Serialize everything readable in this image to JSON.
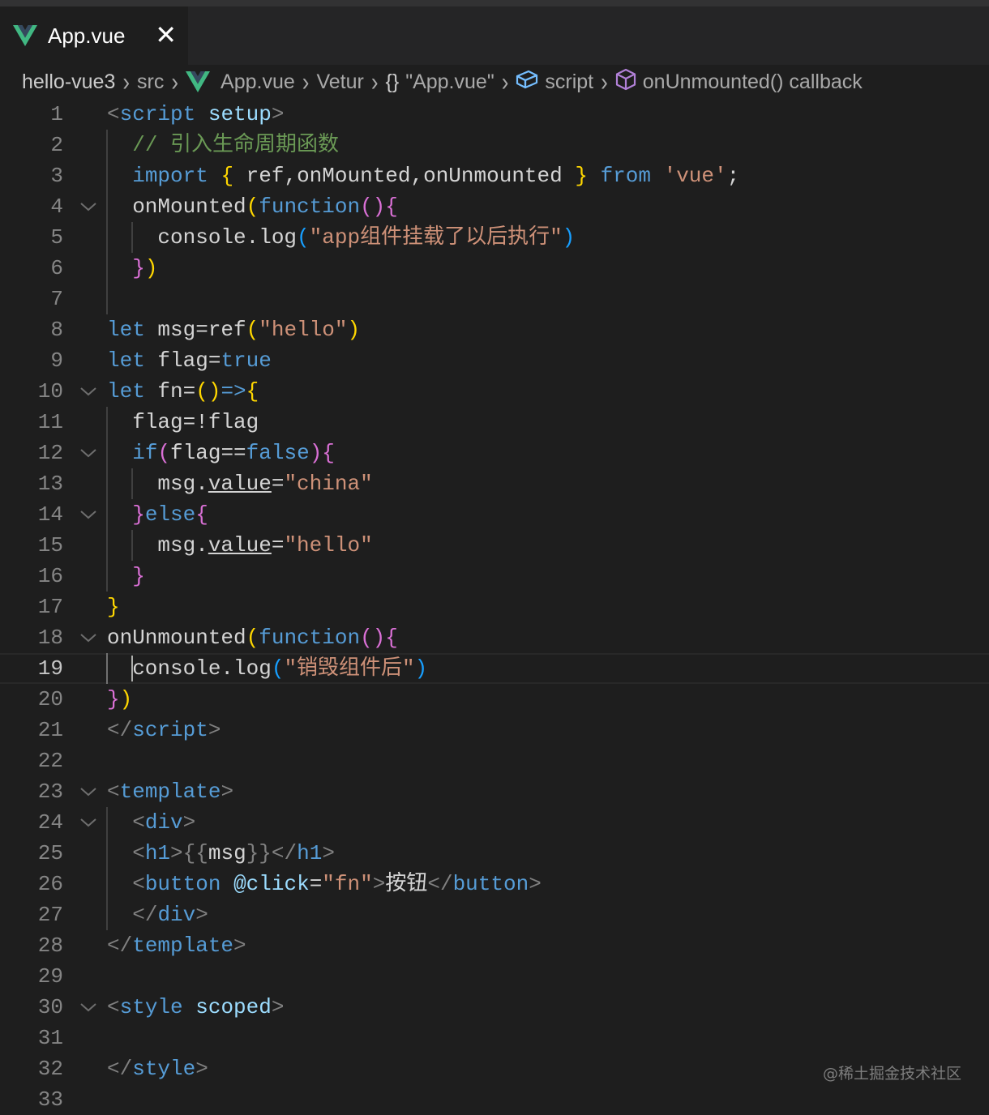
{
  "tab": {
    "title": "App.vue",
    "close": "✕"
  },
  "breadcrumb": [
    {
      "label": "hello-vue3",
      "icon": ""
    },
    {
      "label": "src",
      "icon": ""
    },
    {
      "label": "App.vue",
      "icon": "vue-logo-icon"
    },
    {
      "label": "Vetur",
      "icon": ""
    },
    {
      "label": "\"App.vue\"",
      "icon": "braces-icon",
      "icon_text": "{}"
    },
    {
      "label": "script",
      "icon": "module-cube-icon"
    },
    {
      "label": "onUnmounted() callback",
      "icon": "method-cube-icon"
    }
  ],
  "editor": {
    "current_line": 19,
    "lines": [
      {
        "n": "1",
        "fold": false,
        "tokens": [
          [
            "t-tag",
            "<"
          ],
          [
            "t-tn",
            "script"
          ],
          [
            "t-id",
            " "
          ],
          [
            "t-attr",
            "setup"
          ],
          [
            "t-tag",
            ">"
          ]
        ]
      },
      {
        "n": "2",
        "fold": false,
        "tokens": [
          [
            "t-id",
            "  "
          ],
          [
            "t-cm",
            "// 引入生命周期函数"
          ]
        ]
      },
      {
        "n": "3",
        "fold": false,
        "tokens": [
          [
            "t-id",
            "  "
          ],
          [
            "t-kw",
            "import"
          ],
          [
            "t-id",
            " "
          ],
          [
            "t-b1",
            "{"
          ],
          [
            "t-id",
            " ref,onMounted,onUnmounted "
          ],
          [
            "t-b1",
            "}"
          ],
          [
            "t-id",
            " "
          ],
          [
            "t-kw",
            "from"
          ],
          [
            "t-id",
            " "
          ],
          [
            "t-str",
            "'vue'"
          ],
          [
            "t-id",
            ";"
          ]
        ]
      },
      {
        "n": "4",
        "fold": true,
        "tokens": [
          [
            "t-id",
            "  onMounted"
          ],
          [
            "t-b1",
            "("
          ],
          [
            "t-kw",
            "function"
          ],
          [
            "t-b2",
            "()"
          ],
          [
            "t-b2",
            "{"
          ]
        ]
      },
      {
        "n": "5",
        "fold": false,
        "tokens": [
          [
            "t-id",
            "    console.log"
          ],
          [
            "t-b3",
            "("
          ],
          [
            "t-str",
            "\"app组件挂载了以后执行\""
          ],
          [
            "t-b3",
            ")"
          ]
        ]
      },
      {
        "n": "6",
        "fold": false,
        "tokens": [
          [
            "t-id",
            "  "
          ],
          [
            "t-b2",
            "}"
          ],
          [
            "t-b1",
            ")"
          ]
        ]
      },
      {
        "n": "7",
        "fold": false,
        "tokens": []
      },
      {
        "n": "8",
        "fold": false,
        "tokens": [
          [
            "t-kw",
            "let"
          ],
          [
            "t-id",
            " msg=ref"
          ],
          [
            "t-b1",
            "("
          ],
          [
            "t-str",
            "\"hello\""
          ],
          [
            "t-b1",
            ")"
          ]
        ]
      },
      {
        "n": "9",
        "fold": false,
        "tokens": [
          [
            "t-kw",
            "let"
          ],
          [
            "t-id",
            " flag="
          ],
          [
            "t-kw",
            "true"
          ]
        ]
      },
      {
        "n": "10",
        "fold": true,
        "tokens": [
          [
            "t-kw",
            "let"
          ],
          [
            "t-id",
            " fn="
          ],
          [
            "t-b1",
            "()"
          ],
          [
            "t-kw",
            "=>"
          ],
          [
            "t-b1",
            "{"
          ]
        ]
      },
      {
        "n": "11",
        "fold": false,
        "tokens": [
          [
            "t-id",
            "  flag=!flag"
          ]
        ]
      },
      {
        "n": "12",
        "fold": true,
        "tokens": [
          [
            "t-id",
            "  "
          ],
          [
            "t-kw",
            "if"
          ],
          [
            "t-b2",
            "("
          ],
          [
            "t-id",
            "flag=="
          ],
          [
            "t-kw",
            "false"
          ],
          [
            "t-b2",
            ")"
          ],
          [
            "t-b2",
            "{"
          ]
        ]
      },
      {
        "n": "13",
        "fold": false,
        "tokens": [
          [
            "t-id",
            "    msg."
          ],
          [
            "t-ul",
            "value"
          ],
          [
            "t-id",
            "="
          ],
          [
            "t-str",
            "\"china\""
          ]
        ]
      },
      {
        "n": "14",
        "fold": true,
        "tokens": [
          [
            "t-id",
            "  "
          ],
          [
            "t-b2",
            "}"
          ],
          [
            "t-kw",
            "else"
          ],
          [
            "t-b2",
            "{"
          ]
        ]
      },
      {
        "n": "15",
        "fold": false,
        "tokens": [
          [
            "t-id",
            "    msg."
          ],
          [
            "t-ul",
            "value"
          ],
          [
            "t-id",
            "="
          ],
          [
            "t-str",
            "\"hello\""
          ]
        ]
      },
      {
        "n": "16",
        "fold": false,
        "tokens": [
          [
            "t-id",
            "  "
          ],
          [
            "t-b2",
            "}"
          ]
        ]
      },
      {
        "n": "17",
        "fold": false,
        "tokens": [
          [
            "t-b1",
            "}"
          ]
        ]
      },
      {
        "n": "18",
        "fold": true,
        "tokens": [
          [
            "t-id",
            "onUnmounted"
          ],
          [
            "t-b1",
            "("
          ],
          [
            "t-kw",
            "function"
          ],
          [
            "t-b2",
            "()"
          ],
          [
            "t-b2",
            "{"
          ]
        ]
      },
      {
        "n": "19",
        "fold": false,
        "tokens": [
          [
            "t-id",
            "  console.log"
          ],
          [
            "t-b3",
            "("
          ],
          [
            "t-str",
            "\"销毁组件后\""
          ],
          [
            "t-b3",
            ")"
          ]
        ]
      },
      {
        "n": "20",
        "fold": false,
        "tokens": [
          [
            "t-b2",
            "}"
          ],
          [
            "t-b1",
            ")"
          ]
        ]
      },
      {
        "n": "21",
        "fold": false,
        "tokens": [
          [
            "t-tag",
            "</"
          ],
          [
            "t-tn",
            "script"
          ],
          [
            "t-tag",
            ">"
          ]
        ]
      },
      {
        "n": "22",
        "fold": false,
        "tokens": []
      },
      {
        "n": "23",
        "fold": true,
        "tokens": [
          [
            "t-tag",
            "<"
          ],
          [
            "t-tn",
            "template"
          ],
          [
            "t-tag",
            ">"
          ]
        ]
      },
      {
        "n": "24",
        "fold": true,
        "tokens": [
          [
            "t-id",
            "  "
          ],
          [
            "t-tag",
            "<"
          ],
          [
            "t-tn",
            "div"
          ],
          [
            "t-tag",
            ">"
          ]
        ]
      },
      {
        "n": "25",
        "fold": false,
        "tokens": [
          [
            "t-id",
            "  "
          ],
          [
            "t-tag",
            "<"
          ],
          [
            "t-tn",
            "h1"
          ],
          [
            "t-tag",
            ">"
          ],
          [
            "t-pun",
            "{{"
          ],
          [
            "t-id",
            "msg"
          ],
          [
            "t-pun",
            "}}"
          ],
          [
            "t-tag",
            "</"
          ],
          [
            "t-tn",
            "h1"
          ],
          [
            "t-tag",
            ">"
          ]
        ]
      },
      {
        "n": "26",
        "fold": false,
        "tokens": [
          [
            "t-id",
            "  "
          ],
          [
            "t-tag",
            "<"
          ],
          [
            "t-tn",
            "button"
          ],
          [
            "t-id",
            " "
          ],
          [
            "t-attr",
            "@click"
          ],
          [
            "t-id",
            "="
          ],
          [
            "t-str",
            "\"fn\""
          ],
          [
            "t-tag",
            ">"
          ],
          [
            "t-id",
            "按钮"
          ],
          [
            "t-tag",
            "</"
          ],
          [
            "t-tn",
            "button"
          ],
          [
            "t-tag",
            ">"
          ]
        ]
      },
      {
        "n": "27",
        "fold": false,
        "tokens": [
          [
            "t-id",
            "  "
          ],
          [
            "t-tag",
            "</"
          ],
          [
            "t-tn",
            "div"
          ],
          [
            "t-tag",
            ">"
          ]
        ]
      },
      {
        "n": "28",
        "fold": false,
        "tokens": [
          [
            "t-tag",
            "</"
          ],
          [
            "t-tn",
            "template"
          ],
          [
            "t-tag",
            ">"
          ]
        ]
      },
      {
        "n": "29",
        "fold": false,
        "tokens": []
      },
      {
        "n": "30",
        "fold": true,
        "tokens": [
          [
            "t-tag",
            "<"
          ],
          [
            "t-tn",
            "style"
          ],
          [
            "t-id",
            " "
          ],
          [
            "t-attr",
            "scoped"
          ],
          [
            "t-tag",
            ">"
          ]
        ]
      },
      {
        "n": "31",
        "fold": false,
        "tokens": []
      },
      {
        "n": "32",
        "fold": false,
        "tokens": [
          [
            "t-tag",
            "</"
          ],
          [
            "t-tn",
            "style"
          ],
          [
            "t-tag",
            ">"
          ]
        ]
      },
      {
        "n": "33",
        "fold": false,
        "tokens": []
      }
    ]
  },
  "watermark": "@稀土掘金技术社区",
  "colors": {
    "background": "#1e1e1e",
    "vue_green": "#41b883",
    "vue_dark": "#35495e",
    "icon_blue": "#75beff",
    "icon_purple": "#b180d7"
  }
}
